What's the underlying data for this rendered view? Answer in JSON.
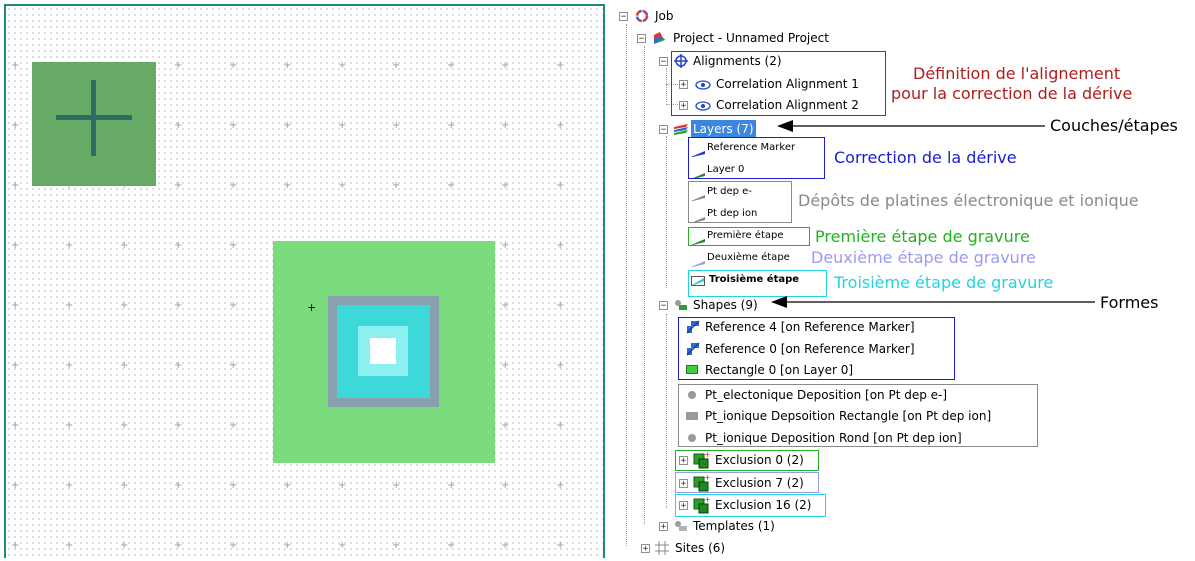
{
  "tree": {
    "job": "Job",
    "project": "Project - Unnamed Project",
    "alignments": "Alignments (2)",
    "alignment_items": [
      "Correlation Alignment 1",
      "Correlation Alignment 2"
    ],
    "layers": "Layers (7)",
    "layer_items": [
      "Reference Marker",
      "Layer 0",
      "Pt dep e-",
      "Pt dep ion",
      "Première étape",
      "Deuxième étape",
      "Troisième étape"
    ],
    "shapes": "Shapes (9)",
    "shape_items": [
      "Reference 4 [on Reference Marker]",
      "Reference 0 [on Reference Marker]",
      "Rectangle 0 [on Layer 0]",
      "Pt_electonique Deposition [on Pt dep e-]",
      "Pt_ionique Depsoition Rectangle [on Pt dep ion]",
      "Pt_ionique Deposition Rond [on Pt dep ion]",
      "Exclusion 0 (2)",
      "Exclusion 7 (2)",
      "Exclusion 16 (2)"
    ],
    "templates": "Templates (1)",
    "sites": "Sites (6)"
  },
  "annotations": {
    "alignment_def_line1": "Définition de l'alignement",
    "alignment_def_line2": "pour la correction de la dérive",
    "layers_steps": "Couches/étapes",
    "drift_correction": "Correction de la dérive",
    "deposits": "Dépôts de platines électronique et ionique",
    "first_step": "Première étape de gravure",
    "second_step": "Deuxième étape de gravure",
    "third_step": "Troisième étape de gravure",
    "forms": "Formes"
  },
  "colors": {
    "red": "#b01c1c",
    "blue": "#1c1ccf",
    "gray": "#8a8a8a",
    "green": "#22b11f",
    "lavender": "#9a9af0",
    "cyan": "#22d3e0",
    "selection": "#3b86e0",
    "frame": "#1e8a7a"
  }
}
